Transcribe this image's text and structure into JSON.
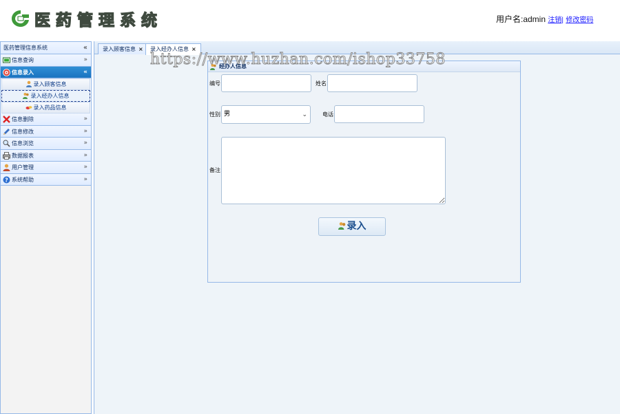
{
  "header": {
    "logo_text": "医药管理系统",
    "user_label": "用户名:admin",
    "logout_link": "注销",
    "separator": "|",
    "change_password_link": "修改密码"
  },
  "sidebar": {
    "title": "医药管理信息系统",
    "collapse_icon": "«",
    "sections": [
      {
        "label": "信息查询",
        "icon": "monitor-icon",
        "expanded": false
      },
      {
        "label": "信息录入",
        "icon": "target-icon",
        "expanded": true,
        "items": [
          {
            "label": "录入顾客信息",
            "icon": "user-icon"
          },
          {
            "label": "录入经办人信息",
            "icon": "users-icon",
            "selected": true
          },
          {
            "label": "录入药品信息",
            "icon": "pills-icon"
          }
        ]
      },
      {
        "label": "信息删除",
        "icon": "delete-x-icon",
        "expanded": false
      },
      {
        "label": "信息修改",
        "icon": "pencil-icon",
        "expanded": false
      },
      {
        "label": "信息浏览",
        "icon": "magnifier-icon",
        "expanded": false
      },
      {
        "label": "数据报表",
        "icon": "printer-icon",
        "expanded": false
      },
      {
        "label": "用户管理",
        "icon": "user-admin-icon",
        "expanded": false
      },
      {
        "label": "系统帮助",
        "icon": "help-icon",
        "expanded": false
      }
    ]
  },
  "tabs": [
    {
      "label": "录入顾客信息",
      "close": "×",
      "active": false
    },
    {
      "label": "录入经办人信息",
      "close": "×",
      "active": true
    }
  ],
  "form": {
    "title": "经办人信息",
    "id_label": "编号:",
    "id_value": "",
    "name_label": "姓名:",
    "name_value": "",
    "gender_label": "性别:",
    "gender_value": "男",
    "phone_label": "电话:",
    "phone_value": "",
    "remark_label": "备注:",
    "remark_value": "",
    "submit_label": "录入"
  },
  "watermark": "https://www.huzhan.com/ishop33758",
  "colors": {
    "accent": "#1a73c0",
    "border": "#95b8e7",
    "panel_bg": "#eef4f9"
  }
}
